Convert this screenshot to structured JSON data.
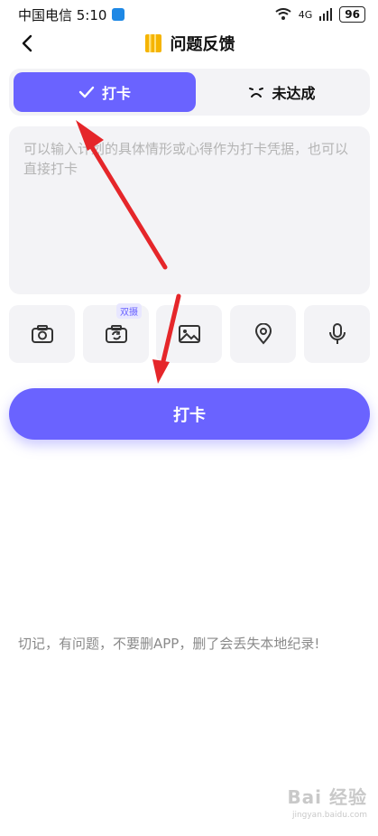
{
  "status_bar": {
    "carrier_time": "中国电信 5:10",
    "network": "4G",
    "battery": "96"
  },
  "header": {
    "title": "问题反馈"
  },
  "tabs": {
    "checkin_label": "打卡",
    "missed_label": "未达成"
  },
  "input": {
    "placeholder": "可以输入计划的具体情形或心得作为打卡凭据，也可以直接打卡"
  },
  "tools": {
    "dual_badge": "双摄",
    "icons": [
      "camera-icon",
      "dual-camera-icon",
      "image-icon",
      "location-icon",
      "microphone-icon"
    ]
  },
  "actions": {
    "checkin_button": "打卡"
  },
  "note": {
    "text": "切记，有问题，不要删APP，删了会丢失本地纪录!"
  },
  "watermark": {
    "top": "Bai 经验",
    "url": "jingyan.baidu.com"
  },
  "colors": {
    "accent": "#6a63ff",
    "panel": "#f3f3f6",
    "annotation_arrow": "#e5262a"
  }
}
